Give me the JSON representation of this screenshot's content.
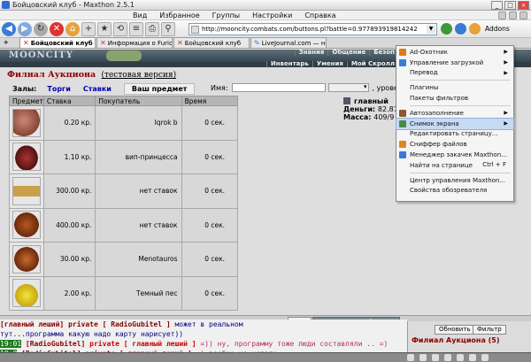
{
  "window": {
    "title": "Бойцовский клуб - Maxthon 2.5.1"
  },
  "menu": [
    "Вид",
    "Избранное",
    "Группы",
    "Настройки",
    "Справка"
  ],
  "address": {
    "url": "http://mooncity.combats.com/buttons.pl?battle=0.977893919814242"
  },
  "toolbar": {
    "addons_label": "Addons"
  },
  "tabs": [
    {
      "label": "Бойцовский клуб",
      "active": true
    },
    {
      "label": "Информация о Furios",
      "active": false
    },
    {
      "label": "Бойцовский клуб",
      "active": false
    },
    {
      "label": "LiveJournal.com — начните сво...",
      "active": false
    }
  ],
  "game": {
    "logo": "MOONCITY",
    "nav_top": [
      "Знания",
      "Общение",
      "Безоп"
    ],
    "nav_bottom": [
      "Инвентарь",
      "Умения",
      "Мой Скролл"
    ]
  },
  "auction": {
    "title": "Филиал Аукциона",
    "test_link": "(тестовая версия)",
    "halls_label": "Залы:",
    "hall_links": [
      "Торги",
      "Ставки"
    ],
    "hall_active": "Ваш предмет",
    "name_label": "Имя:",
    "level_label": ", уровень:",
    "headers": [
      "Предмет",
      "Ставка",
      "Покупатель",
      "Время"
    ],
    "rows": [
      {
        "bid": "0.20 кр.",
        "buyer": "Iqrok b",
        "time": "0 сек."
      },
      {
        "bid": "1.10 кр.",
        "buyer": "вип-принцесса",
        "time": "0 сек."
      },
      {
        "bid": "300.00 кр.",
        "buyer": "нет ставок",
        "time": "0 сек."
      },
      {
        "bid": "400.00 кр.",
        "buyer": "нет ставок",
        "time": "0 сек."
      },
      {
        "bid": "30.00 кр.",
        "buyer": "Menotauros",
        "time": "0 сек."
      },
      {
        "bid": "2.00 кр.",
        "buyer": "Темный пес",
        "time": "0 сек."
      }
    ]
  },
  "player": {
    "name": "главный",
    "money_label": "Деньги:",
    "money_value": "82.87",
    "mass_label": "Масса:",
    "mass_value": "409/9"
  },
  "context_menu": [
    {
      "label": "Ad-Охотник",
      "submenu": true,
      "color": "#e07a1e"
    },
    {
      "label": "Управление загрузкой",
      "submenu": true,
      "color": "#3a7bd5"
    },
    {
      "label": "Перевод",
      "submenu": true,
      "color": ""
    },
    {
      "sep": true
    },
    {
      "label": "Плагины",
      "submenu": false,
      "color": ""
    },
    {
      "label": "Пакеты фильтров",
      "submenu": false,
      "color": ""
    },
    {
      "sep": true
    },
    {
      "label": "Автозаполнение",
      "submenu": true,
      "color": "#8a5a2e"
    },
    {
      "label": "Снимок экрана",
      "submenu": true,
      "color": "#4a8a4a",
      "highlight": true
    },
    {
      "label": "Редактировать страницу...",
      "submenu": false,
      "color": ""
    },
    {
      "label": "Сниффер файлов",
      "submenu": false,
      "color": "#d88a1e"
    },
    {
      "label": "Менеджер закачек Maxthon...",
      "submenu": false,
      "color": "#3a7bd5"
    },
    {
      "label": "Найти на странице",
      "shortcut": "Ctrl + F",
      "submenu": false,
      "color": ""
    },
    {
      "sep": true
    },
    {
      "label": "Центр управления Maxthon...",
      "submenu": false,
      "color": ""
    },
    {
      "label": "Свойства обозревателя",
      "submenu": false,
      "color": ""
    }
  ],
  "chat": {
    "tab_chat": "Чат",
    "tab_system": "Системные сообщения",
    "lines": [
      {
        "time": "",
        "parts": [
          {
            "cls": "nick",
            "t": "[главный леший] private [ RadioGubitel ] "
          },
          {
            "cls": "msg-blue",
            "t": "может в реальном"
          }
        ]
      },
      {
        "time": "",
        "parts": [
          {
            "cls": "msg-blue",
            "t": "тут...программа какую надо карту нарисует))"
          }
        ]
      },
      {
        "time": "19:01",
        "parts": [
          {
            "cls": "nick",
            "t": "[RadioGubitel] "
          },
          {
            "cls": "priv",
            "t": "private [ главный леший ] "
          },
          {
            "cls": "msg-pink",
            "t": "=)) ну, программу тоже люди составляли .. =)"
          }
        ]
      },
      {
        "time": "19:0",
        "parts": [
          {
            "cls": "nick",
            "t": "[RadioGubitel] "
          },
          {
            "cls": "priv",
            "t": "private [ главный леший ] "
          },
          {
            "cls": "msg-pink",
            "t": "=) вообще не устали"
          }
        ]
      }
    ],
    "first_time": "19:01"
  },
  "side_panel": {
    "refresh": "Обновить",
    "filter": "Фильтр",
    "location": "Филиал Аукциона (5)"
  }
}
